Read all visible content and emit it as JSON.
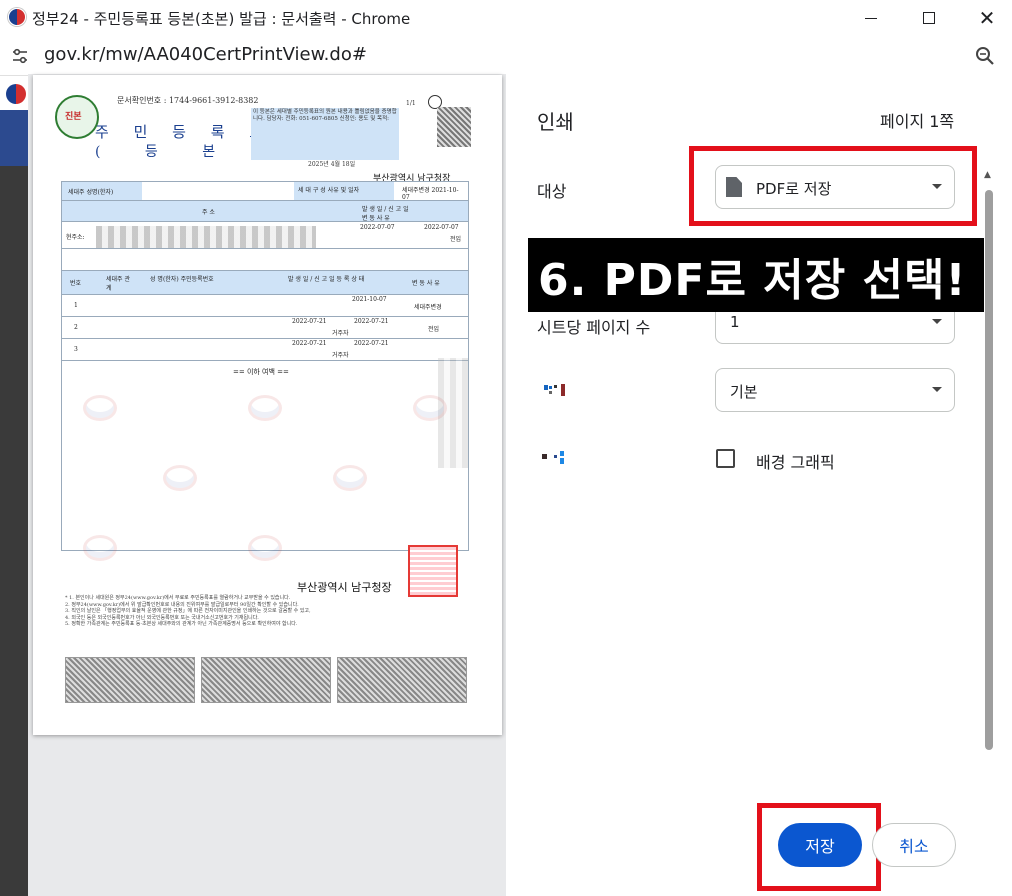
{
  "window": {
    "title": "정부24 - 주민등록표 등본(초본) 발급 : 문서출력 - Chrome",
    "minimize_icon": "minimize-icon",
    "maximize_icon": "maximize-icon",
    "close_icon": "close-icon",
    "close_glyph": "✕"
  },
  "address_bar": {
    "url": "gov.kr/mw/AA040CertPrintView.do#",
    "site_info_icon": "tune-icon",
    "zoom_icon": "zoom-icon"
  },
  "document": {
    "doc_number": "문서확인번호 : 1744-9661-3912-8382",
    "page": "1/1",
    "seal_text": "진본",
    "title": "주 민 등 록 표",
    "subtitle": "( 등 본 )",
    "cert_text": "이 등본은 세대별 주민등록표의 원본 내용과 틀림없음을 증명합니다. 담당자: 전화: 051-607-6805 신청인: 용도 및 목적:",
    "issue_date": "2025년 4월 18일",
    "office": "부산광역시 남구청장",
    "table": {
      "head_owner": "세대주 성명(한자)",
      "head_composition": "세 대 구 성 사유 및 일자",
      "composition_value": "세대주변경 2021-10-07",
      "head_address": "주 소",
      "head_date": "발 생 일 / 신 고 일",
      "head_change": "변 동 사 유",
      "address_label": "현주소:",
      "address_date1": "2022-07-07",
      "address_date2": "2022-07-07",
      "address_reason": "전입",
      "col_no": "번호",
      "col_relation": "세대주 관계",
      "col_name": "성 명(한자) 주민등록번호",
      "col_date": "발 생 일 / 신 고 일 등 록 상 태",
      "col_reason": "변 동 사 유",
      "rows": [
        {
          "no": "1",
          "date1": "2021-10-07",
          "date2": "",
          "status": "",
          "reason": "세대주변경"
        },
        {
          "no": "2",
          "date1": "2022-07-21",
          "date2": "2022-07-21",
          "status": "거주자",
          "reason": "전입"
        },
        {
          "no": "3",
          "date1": "2022-07-21",
          "date2": "2022-07-21",
          "status": "거주자",
          "reason": ""
        }
      ],
      "end_mark": "== 이하 여백 =="
    },
    "footer_office": "부산광역시 남구청장",
    "notes": [
      "* 1. 본인이나 세대원은 정부24(www.gov.kr)에서 무료로 주민등록표를 열람하거나 교부받을 수 있습니다.",
      "2. 정부24(www.gov.kr)에서 위 발급확인번호로 내용의 진위여부를 발급일로부터 90일간 확인할 수 있습니다.",
      "3. 직인의 날인은 「행정업무의 효율적 운영에 관한 규정」에 따른 전자이미지관인을 인쇄하는 것으로 갈음할 수 있고,",
      "4. 외국인 등은 외국인등록번호가 아닌 외국인등록번호 또는 국내거소신고번호가 기재됩니다.",
      "5. 정확한 가족관계는 주민등록표 등·초본상 세대주와의 관계가 아닌 가족관계증명서 등으로 확인하여야 합니다."
    ]
  },
  "print_dialog": {
    "title": "인쇄",
    "page_count": "페이지 1쪽",
    "destination_label": "대상",
    "destination_value": "PDF로 저장",
    "destination_icon": "document-icon",
    "pages_per_sheet_label": "시트당 페이지 수",
    "pages_per_sheet_value": "1",
    "margins_icon": "margins-icon",
    "margins_value": "기본",
    "options_icon": "options-icon",
    "background_graphics_label": "배경 그래픽",
    "background_graphics_checked": false,
    "save_button": "저장",
    "cancel_button": "취소",
    "accent_color": "#0b57d0"
  },
  "annotation": {
    "text": "6. PDF로 저장 선택!",
    "highlight_color": "#e3101a"
  }
}
